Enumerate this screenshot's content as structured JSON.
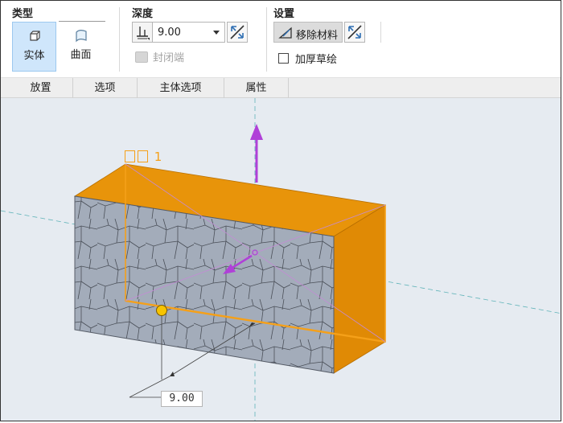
{
  "ribbon": {
    "type_group": {
      "title": "类型",
      "solid_label": "实体",
      "surface_label": "曲面"
    },
    "depth_group": {
      "title": "深度",
      "depth_value": "9.00",
      "capped_label": "封闭端"
    },
    "settings_group": {
      "title": "设置",
      "remove_material_label": "移除材料",
      "thicken_label": "加厚草绘"
    }
  },
  "tabs": [
    "放置",
    "选项",
    "主体选项",
    "属性"
  ],
  "viewport": {
    "sketch_label": "1",
    "dimension_value": "9.00"
  },
  "colors": {
    "accent_blue": "#cfe6fb",
    "sketch_orange": "#f5a019",
    "extrude_fill": "#e8940a",
    "arrow_purple": "#b040d8",
    "viewport_bg": "#e6ebf1"
  },
  "icons": [
    "solid-icon",
    "surface-icon",
    "depth-blind-icon",
    "flip-direction-icon",
    "capped-ends-icon",
    "remove-material-icon",
    "checkbox-icon"
  ]
}
